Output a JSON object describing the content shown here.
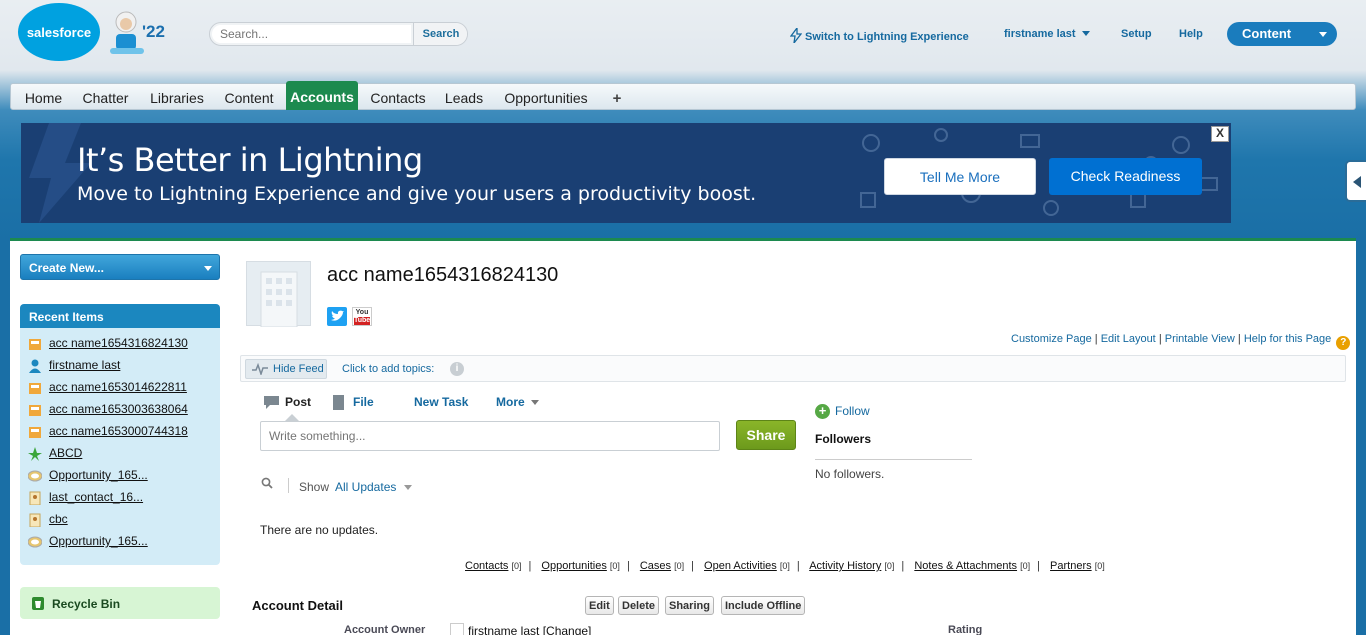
{
  "header": {
    "logo_text": "salesforce",
    "year_badge": "'22",
    "search_placeholder": "Search...",
    "search_button": "Search",
    "lightning_link": "Switch to Lightning Experience",
    "user_menu": "firstname last",
    "setup": "Setup",
    "help": "Help",
    "app_menu": "Content"
  },
  "tabs": [
    "Home",
    "Chatter",
    "Libraries",
    "Content",
    "Accounts",
    "Contacts",
    "Leads",
    "Opportunities"
  ],
  "active_tab": "Accounts",
  "tab_plus": "+",
  "banner": {
    "title": "It’s Better in Lightning",
    "subtitle": "Move to Lightning Experience and give your users a productivity boost.",
    "tell_me_more": "Tell Me More",
    "check_readiness": "Check Readiness",
    "close": "X"
  },
  "sidebar": {
    "create_new": "Create New...",
    "recent_items_title": "Recent Items",
    "recent_items": [
      {
        "label": "acc name1654316824130",
        "icon": "account-icon"
      },
      {
        "label": "firstname last",
        "icon": "user-icon"
      },
      {
        "label": "acc name1653014622811",
        "icon": "account-icon"
      },
      {
        "label": "acc name1653003638064",
        "icon": "account-icon"
      },
      {
        "label": "acc name1653000744318",
        "icon": "account-icon"
      },
      {
        "label": "ABCD",
        "icon": "lead-icon"
      },
      {
        "label": "Opportunity_165...",
        "icon": "opportunity-icon"
      },
      {
        "label": "last_contact_16...",
        "icon": "contact-icon"
      },
      {
        "label": "cbc",
        "icon": "contact-icon"
      },
      {
        "label": "Opportunity_165...",
        "icon": "opportunity-icon"
      }
    ],
    "recycle_bin": "Recycle Bin"
  },
  "account": {
    "name": "acc name1654316824130",
    "youtube_you": "You",
    "youtube_tube": "Tube"
  },
  "page_links": {
    "customize": "Customize Page",
    "edit_layout": "Edit Layout",
    "printable": "Printable View",
    "help": "Help for this Page",
    "separator": "|",
    "help_glyph": "?"
  },
  "feed": {
    "hide_feed": "Hide Feed",
    "add_topics": "Click to add topics:",
    "info_glyph": "i",
    "post": "Post",
    "file": "File",
    "new_task": "New Task",
    "more": "More",
    "placeholder": "Write something...",
    "share": "Share",
    "show": "Show",
    "filter": "All Updates",
    "no_updates": "There are no updates."
  },
  "follow": {
    "follow_glyph": "+",
    "follow": "Follow",
    "followers": "Followers",
    "no_followers": "No followers."
  },
  "related": [
    {
      "label": "Contacts",
      "count": "[0]"
    },
    {
      "label": "Opportunities",
      "count": "[0]"
    },
    {
      "label": "Cases",
      "count": "[0]"
    },
    {
      "label": "Open Activities",
      "count": "[0]"
    },
    {
      "label": "Activity History",
      "count": "[0]"
    },
    {
      "label": "Notes & Attachments",
      "count": "[0]"
    },
    {
      "label": "Partners",
      "count": "[0]"
    }
  ],
  "related_separator": "|",
  "detail": {
    "title": "Account Detail",
    "buttons": [
      "Edit",
      "Delete",
      "Sharing",
      "Include Offline"
    ],
    "owner_label": "Account Owner",
    "owner_value": "firstname last [Change]",
    "rating_label": "Rating"
  },
  "colors": {
    "accent_blue": "#15699f",
    "active_tab_green": "#1c8a4f",
    "banner_navy": "#1a3f73",
    "share_green": "#7aa824"
  }
}
